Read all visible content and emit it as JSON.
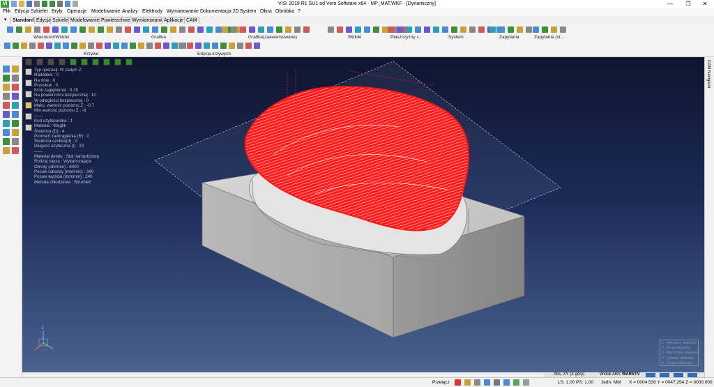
{
  "window": {
    "title": "VISI 2019 R1 SU1 od Vero Software x64 - MP_MAT.WKF - [Dynamiczny]",
    "logo": "VI",
    "controls": {
      "minimize": "—",
      "restore": "❐",
      "close": "✕"
    }
  },
  "menu": [
    "Plik",
    "Edycja",
    "Szkielet",
    "Bryły",
    "Operacje",
    "Modelowanie",
    "Analizy",
    "Elektrody",
    "Wymiarowanie",
    "Dokumentacja 2D",
    "System",
    "Okna",
    "Obróbka",
    "?"
  ],
  "tabs": [
    "Standard",
    "Edycja",
    "Szkielet",
    "Modelowanie",
    "Powierzchnie",
    "Wymiarowanie",
    "Aplikacje",
    "CAM"
  ],
  "active_tab": "Standard",
  "ribbon_groups": {
    "row1": [
      "Własności/Widoki",
      "Grafika",
      "Grafika(zaawansowane)",
      "Widoki",
      "Płaszczyzny r...",
      "System",
      "Zapytania",
      "Zapytania (st..."
    ],
    "row2": [
      "Krzywe",
      "Edycja krzywych"
    ]
  },
  "operation_info": [
    "Typ operacji: W stałym Z",
    "Naddatek : 0",
    "Na dnie : 0",
    "Przeskok : 0",
    "Krok zagłębiania : 0.15",
    "Na powierzchni bezpiecznej : 10",
    "W odległości bezpiecznej : 0",
    "Maks. wartość poziomu Z : -0.7",
    "Min wartość poziomu Z : -6",
    "------",
    "Kod użytkownika : 1",
    "Materiał : Węglik",
    "Średnica      (D) : 4",
    "Promień zaokrąglenia (R) : 2",
    "Średnica czubka(d) : 0",
    "Długość użyteczna (l) : 20",
    "------",
    "Materiał detalu : Stal narzędziowa",
    "Rodzaj cięcia : Wykańczająca",
    "Obroty (obr/min) : 6000",
    "Posuw roboczy (mm/min) : 340",
    "Posuw wyjścia (mm/min) : 240",
    "Metoda chłodzenia : Strumień"
  ],
  "legend": [
    "1 - Pierwszy właściwy",
    "2 - Drugi właściwy",
    "3 - Narzędzie właściwe",
    "4 - Uchwyt właściwy",
    "5 - Trzeci właściwy"
  ],
  "right_panel": {
    "label": "CAM Navigator"
  },
  "axis_label": "Z",
  "status": {
    "switch": "Przełącz",
    "coord_mode": "Abs. XY (Z góry)",
    "view": "Widok ABS",
    "layer": "WARSTV",
    "ls_ps": "LS: 1.00 PS: 1.00",
    "units": "Jedn: MM",
    "coords": "X = 0004.530 Y = 0047.254 Z = 0000.000"
  },
  "colors": {
    "toolpath": "#ff1a1a",
    "block": "#c8c8c8",
    "viewport_top": "#0f1530",
    "viewport_bottom": "#4a638e",
    "accent": "#2f6db5"
  }
}
